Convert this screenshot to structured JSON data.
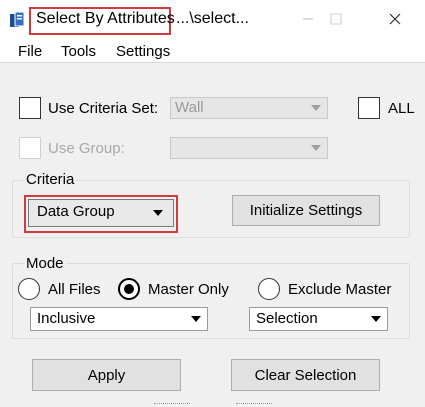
{
  "window": {
    "title": "Select By Attributes",
    "title_suffix": "...\\select..."
  },
  "menu": [
    {
      "label": "File"
    },
    {
      "label": "Tools"
    },
    {
      "label": "Settings"
    }
  ],
  "criteria_set": {
    "checkbox_label": "Use Criteria Set:",
    "checked": false,
    "value": "Wall",
    "all_label": "ALL",
    "all_checked": false
  },
  "group": {
    "checkbox_label": "Use Group:",
    "checked": false,
    "value": ""
  },
  "criteria": {
    "title": "Criteria",
    "dropdown_value": "Data Group",
    "initialize_button": "Initialize Settings"
  },
  "mode": {
    "title": "Mode",
    "options": [
      {
        "label": "All Files",
        "selected": false
      },
      {
        "label": "Master Only",
        "selected": true
      },
      {
        "label": "Exclude Master",
        "selected": false
      }
    ],
    "inclusion_value": "Inclusive",
    "selection_value": "Selection"
  },
  "buttons": {
    "apply": "Apply",
    "clear_selection": "Clear Selection"
  },
  "colors": {
    "highlight": "#d23b3b",
    "background": "#f0f0f0"
  }
}
